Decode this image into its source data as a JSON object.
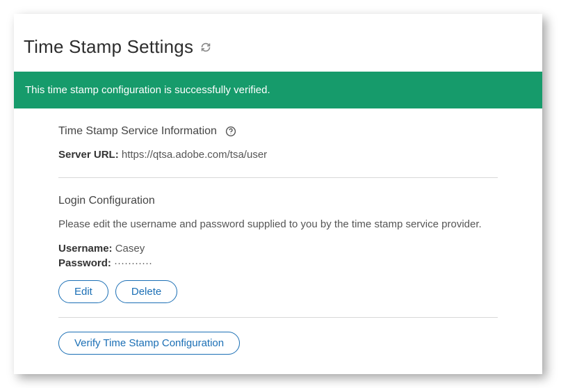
{
  "header": {
    "title": "Time Stamp Settings"
  },
  "alert": {
    "message": "This time stamp configuration is successfully verified."
  },
  "serviceInfo": {
    "title": "Time Stamp Service Information",
    "serverUrlLabel": "Server URL:",
    "serverUrlValue": "https://qtsa.adobe.com/tsa/user"
  },
  "loginConfig": {
    "title": "Login Configuration",
    "description": "Please edit the username and password supplied to you by the time stamp service provider.",
    "usernameLabel": "Username:",
    "usernameValue": "Casey",
    "passwordLabel": "Password:",
    "passwordValue": "···········",
    "editLabel": "Edit",
    "deleteLabel": "Delete"
  },
  "verify": {
    "label": "Verify Time Stamp Configuration"
  }
}
